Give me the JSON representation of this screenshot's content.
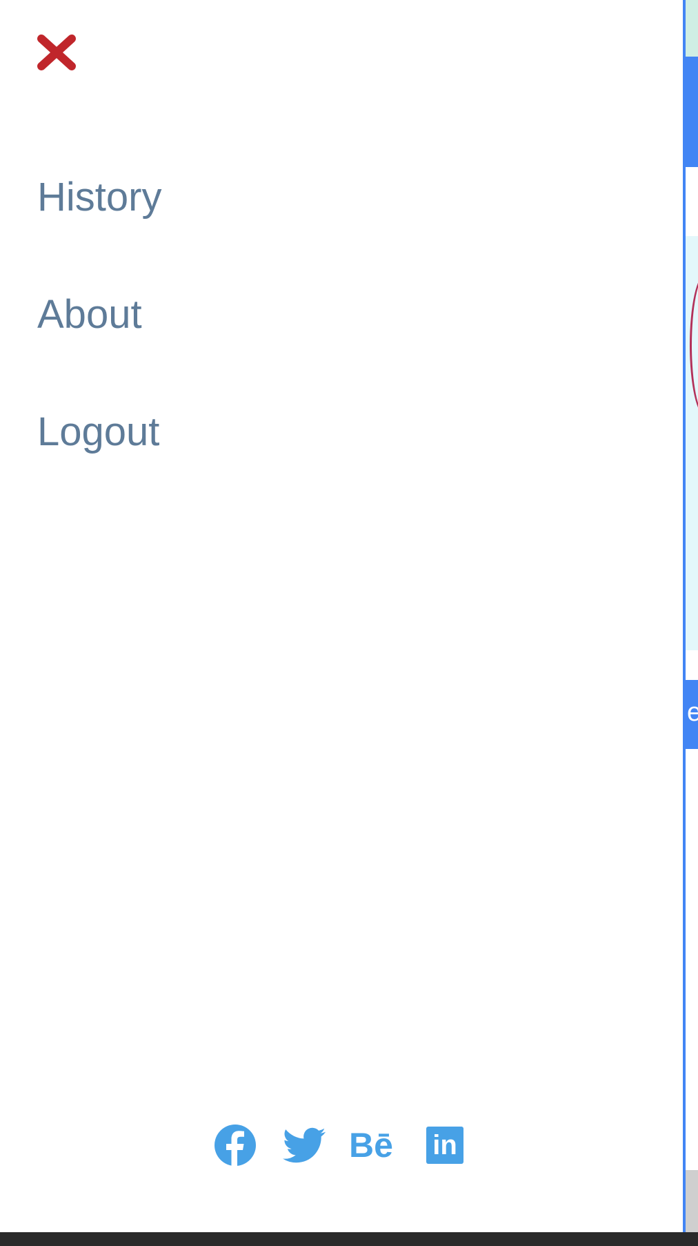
{
  "colors": {
    "close": "#c0262b",
    "nav_text": "#5e7b98",
    "social": "#47a1e6",
    "underlay_blue": "#4285f4",
    "underlay_teal": "#cfeee4",
    "bottom_bar": "#2a2a2a"
  },
  "drawer": {
    "close_icon": "close-icon",
    "nav": [
      {
        "label": "History"
      },
      {
        "label": "About"
      },
      {
        "label": "Logout"
      }
    ],
    "socials": [
      {
        "icon": "facebook-icon"
      },
      {
        "icon": "twitter-icon"
      },
      {
        "icon": "behance-icon",
        "text": "Bē"
      },
      {
        "icon": "linkedin-icon",
        "text": "in"
      }
    ]
  },
  "underlay": {
    "button_fragment": "e"
  }
}
